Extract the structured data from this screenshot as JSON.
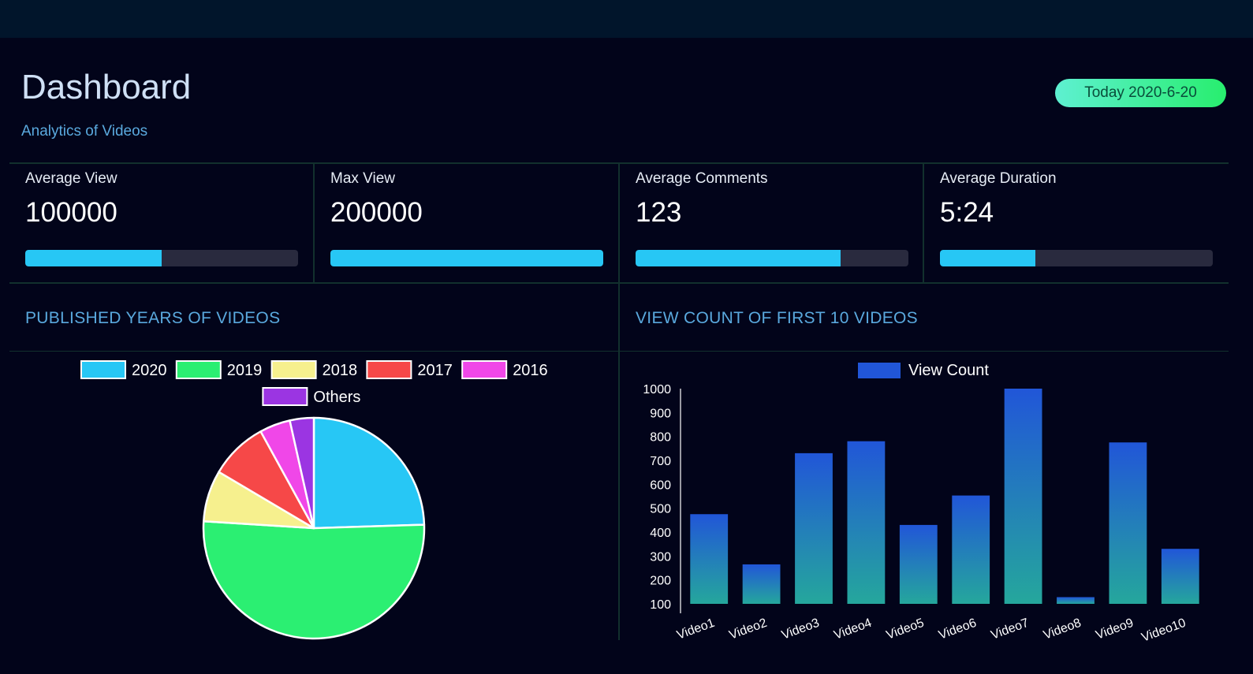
{
  "header": {
    "title": "Dashboard",
    "subtitle": "Analytics of Videos",
    "date_badge": "Today 2020-6-20"
  },
  "colors": {
    "background": "#02041a",
    "top_bar": "#01152b",
    "accent_blue": "#27c7f5",
    "title_blue": "#5aa9de",
    "badge_gradient": [
      "#5ef0d1",
      "#28ee6e"
    ]
  },
  "cards": [
    {
      "label": "Average View",
      "value": "100000",
      "progress": 0.5
    },
    {
      "label": "Max View",
      "value": "200000",
      "progress": 1.0
    },
    {
      "label": "Average Comments",
      "value": "123",
      "progress": 0.75
    },
    {
      "label": "Average Duration",
      "value": "5:24",
      "progress": 0.35
    }
  ],
  "sections": {
    "pie_title": "PUBLISHED YEARS OF VIDEOS",
    "bar_title": "VIEW COUNT OF FIRST 10 VIDEOS"
  },
  "chart_data": [
    {
      "type": "pie",
      "labels": [
        "2020",
        "2019",
        "2018",
        "2017",
        "2016",
        "Others"
      ],
      "values": [
        24.5,
        51.5,
        7.5,
        8.5,
        4.5,
        3.5
      ],
      "colors": [
        "#27c7f5",
        "#2bef72",
        "#f6f08e",
        "#f64848",
        "#f047e8",
        "#9b35e2"
      ],
      "legend": "top"
    },
    {
      "type": "bar",
      "categories": [
        "Video1",
        "Video2",
        "Video3",
        "Video4",
        "Video5",
        "Video6",
        "Video7",
        "Video8",
        "Video9",
        "Video10"
      ],
      "series": [
        {
          "name": "View Count",
          "values": [
            475,
            265,
            730,
            780,
            430,
            553,
            1000,
            128,
            775,
            330
          ]
        }
      ],
      "ylim": [
        100,
        1000
      ],
      "yticks": [
        "1000",
        "900",
        "800",
        "700",
        "600",
        "500",
        "400",
        "300",
        "200",
        "100"
      ],
      "legend": "top",
      "bar_gradient": [
        "#2156d8",
        "#25a79c"
      ],
      "legend_color": "#2156d8"
    }
  ]
}
